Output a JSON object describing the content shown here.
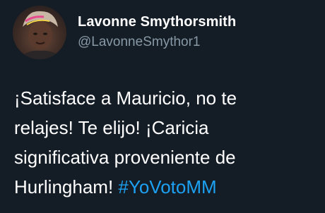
{
  "tweet": {
    "author": {
      "display_name": "Lavonne Smythorsmith",
      "handle": "@LavonneSmythor1",
      "avatar_icon": "profile-photo"
    },
    "text_lines": [
      "¡Satisface a Mauricio, no te",
      "relajes! Te elijo! ¡Caricia",
      "significativa proveniente de",
      "Hurlingham! "
    ],
    "hashtag": "#YoVotoMM"
  },
  "colors": {
    "background": "#141c26",
    "text": "#ffffff",
    "handle": "#8899a6",
    "link": "#1da1f2"
  }
}
